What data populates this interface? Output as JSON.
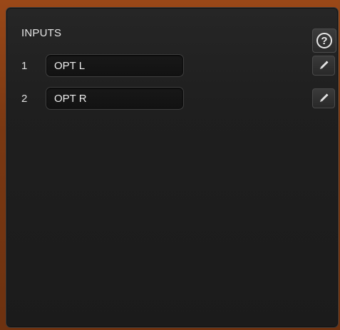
{
  "panel": {
    "title": "INPUTS",
    "help_icon": "question-circle-icon",
    "edit_icon": "pencil-icon"
  },
  "inputs": [
    {
      "number": "1",
      "name": "OPT L"
    },
    {
      "number": "2",
      "name": "OPT R"
    }
  ],
  "colors": {
    "frame_accent": "#b55a1e",
    "panel_background": "#1f1f1f",
    "text": "#e6e6e6"
  }
}
